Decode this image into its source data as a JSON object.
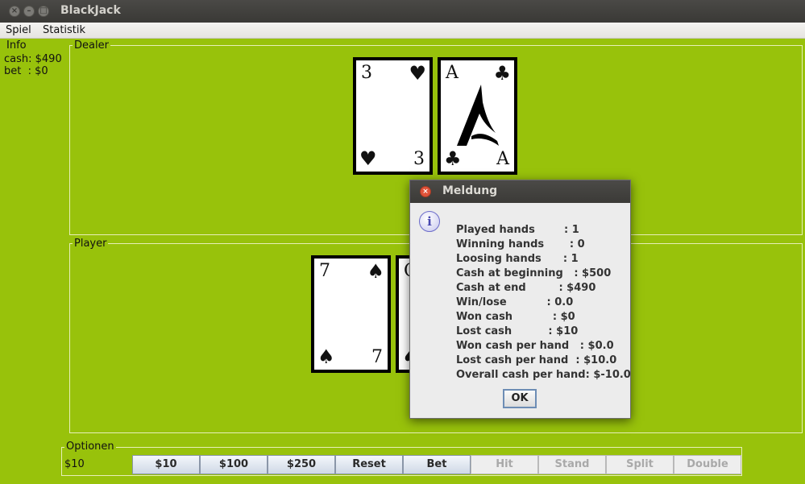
{
  "window": {
    "title": "BlackJack"
  },
  "menu": {
    "items": [
      "Spiel",
      "Statistik"
    ]
  },
  "info": {
    "title": "Info",
    "cash": "cash: $490",
    "bet": "bet  : $0"
  },
  "dealer": {
    "title": "Dealer",
    "cards": [
      {
        "rank": "3",
        "suit": "♥"
      },
      {
        "rank": "A",
        "suit": "♣"
      }
    ]
  },
  "player": {
    "title": "Player",
    "cards": [
      {
        "rank": "7",
        "suit": "♠"
      },
      {
        "rank": "Q",
        "suit": "♠"
      }
    ]
  },
  "options": {
    "title": "Optionen",
    "current_bet": "$10",
    "buttons": [
      {
        "label": "$10",
        "enabled": true
      },
      {
        "label": "$100",
        "enabled": true
      },
      {
        "label": "$250",
        "enabled": true
      },
      {
        "label": "Reset",
        "enabled": true
      },
      {
        "label": "Bet",
        "enabled": true
      },
      {
        "label": "Hit",
        "enabled": false
      },
      {
        "label": "Stand",
        "enabled": false
      },
      {
        "label": "Split",
        "enabled": false
      },
      {
        "label": "Double",
        "enabled": false
      }
    ]
  },
  "dialog": {
    "title": "Meldung",
    "icon": "info-icon",
    "lines": [
      "Played hands        : 1",
      "Winning hands       : 0",
      "Loosing hands      : 1",
      "Cash at beginning   : $500",
      "Cash at end         : $490",
      "Win/lose           : 0.0",
      "Won cash           : $0",
      "Lost cash          : $10",
      "Won cash per hand   : $0.0",
      "Lost cash per hand  : $10.0",
      "Overall cash per hand: $-10.0"
    ],
    "ok_label": "OK"
  },
  "colors": {
    "table_green": "#98c20b",
    "card_border": "#000000",
    "dialog_bg": "#ececec"
  }
}
